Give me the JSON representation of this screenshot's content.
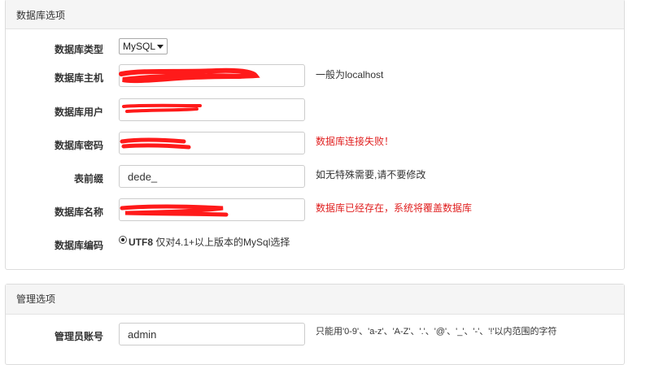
{
  "db_panel": {
    "title": "数据库选项",
    "db_type": {
      "label": "数据库类型",
      "selected": "MySQL"
    },
    "db_host": {
      "label": "数据库主机",
      "value": "",
      "hint": "一般为localhost"
    },
    "db_user": {
      "label": "数据库用户",
      "value": ""
    },
    "db_password": {
      "label": "数据库密码",
      "value": "",
      "error": "数据库连接失败！"
    },
    "table_prefix": {
      "label": "表前缀",
      "value": "dede_",
      "hint": "如无特殊需要,请不要修改"
    },
    "db_name": {
      "label": "数据库名称",
      "value": "",
      "error": "数据库已经存在，系统将覆盖数据库"
    },
    "db_charset": {
      "label": "数据库编码",
      "option_bold": "UTF8",
      "option_text": " 仅对4.1+以上版本的MySql选择"
    }
  },
  "admin_panel": {
    "title": "管理选项",
    "admin_account": {
      "label": "管理员账号",
      "value": "admin",
      "hint": "只能用'0-9'、'a-z'、'A-Z'、'.'、'@'、'_'、'-'、'!'以内范围的字符"
    }
  },
  "colors": {
    "error": "#e02020",
    "redaction": "#ff1a1a"
  }
}
